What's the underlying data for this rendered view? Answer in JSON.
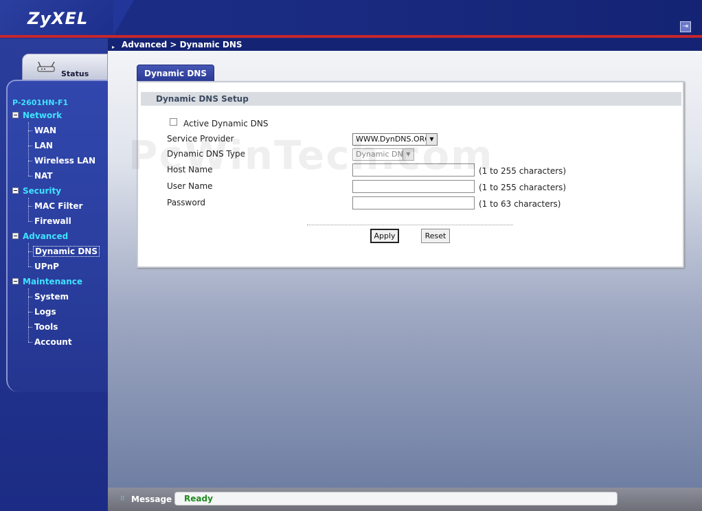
{
  "header": {
    "logo": "ZyXEL"
  },
  "sidebar": {
    "status_label": "Status",
    "device_name": "P-2601HN-F1",
    "groups": [
      {
        "label": "Network",
        "items": [
          "WAN",
          "LAN",
          "Wireless LAN",
          "NAT"
        ]
      },
      {
        "label": "Security",
        "items": [
          "MAC Filter",
          "Firewall"
        ]
      },
      {
        "label": "Advanced",
        "items": [
          "Dynamic DNS",
          "UPnP"
        ]
      },
      {
        "label": "Maintenance",
        "items": [
          "System",
          "Logs",
          "Tools",
          "Account"
        ]
      }
    ],
    "active_item": "Dynamic DNS"
  },
  "breadcrumb": "Advanced > Dynamic DNS",
  "tab": {
    "label": "Dynamic DNS"
  },
  "form": {
    "section_title": "Dynamic DNS Setup",
    "active_label": "Active Dynamic DNS",
    "active_checked": false,
    "service_provider": {
      "label": "Service Provider",
      "value": "WWW.DynDNS.ORG"
    },
    "ddns_type": {
      "label": "Dynamic DNS Type",
      "value": "Dynamic DNS"
    },
    "host_name": {
      "label": "Host Name",
      "value": "",
      "hint": "(1 to 255 characters)"
    },
    "user_name": {
      "label": "User Name",
      "value": "",
      "hint": "(1 to 255 characters)"
    },
    "password": {
      "label": "Password",
      "value": "",
      "hint": "(1 to 63 characters)"
    },
    "apply_label": "Apply",
    "reset_label": "Reset"
  },
  "watermark": "PcWinTech.com",
  "statusbar": {
    "label": "Message",
    "value": "Ready"
  }
}
